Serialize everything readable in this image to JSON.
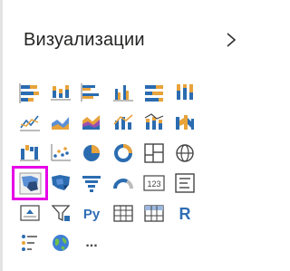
{
  "pane": {
    "title": "Визуализации",
    "collapse_icon": "chevron-right-icon",
    "selected_visual": "shape-map",
    "selection_color": "#e600e6",
    "accent_colors": [
      "#2b6cb0",
      "#e8a33a",
      "#5b8fd6",
      "#9b4fb0"
    ]
  },
  "visuals": [
    {
      "name": "stacked-bar-chart",
      "icon": "stacked-bar-icon"
    },
    {
      "name": "stacked-column-chart",
      "icon": "stacked-column-icon"
    },
    {
      "name": "clustered-bar-chart",
      "icon": "clustered-bar-icon"
    },
    {
      "name": "clustered-column-chart",
      "icon": "clustered-column-icon"
    },
    {
      "name": "100-stacked-bar-chart",
      "icon": "percent-bar-icon"
    },
    {
      "name": "100-stacked-column-chart",
      "icon": "percent-column-icon"
    },
    {
      "name": "line-chart",
      "icon": "line-chart-icon"
    },
    {
      "name": "area-chart",
      "icon": "area-chart-icon"
    },
    {
      "name": "stacked-area-chart",
      "icon": "stacked-area-icon"
    },
    {
      "name": "line-and-clustered-column-chart",
      "icon": "line-column-icon"
    },
    {
      "name": "line-and-stacked-column-chart",
      "icon": "line-stacked-column-icon"
    },
    {
      "name": "ribbon-chart",
      "icon": "ribbon-chart-icon"
    },
    {
      "name": "waterfall-chart",
      "icon": "waterfall-icon"
    },
    {
      "name": "scatter-chart",
      "icon": "scatter-icon"
    },
    {
      "name": "pie-chart",
      "icon": "pie-icon"
    },
    {
      "name": "donut-chart",
      "icon": "donut-icon"
    },
    {
      "name": "treemap",
      "icon": "treemap-icon"
    },
    {
      "name": "map",
      "icon": "globe-icon"
    },
    {
      "name": "shape-map",
      "icon": "shape-map-icon"
    },
    {
      "name": "filled-map",
      "icon": "filled-map-icon"
    },
    {
      "name": "funnel",
      "icon": "funnel-icon"
    },
    {
      "name": "gauge",
      "icon": "gauge-icon"
    },
    {
      "name": "card",
      "icon": "card-icon",
      "label": "123"
    },
    {
      "name": "multi-row-card",
      "icon": "multi-row-card-icon"
    },
    {
      "name": "kpi",
      "icon": "kpi-icon"
    },
    {
      "name": "slicer",
      "icon": "slicer-icon"
    },
    {
      "name": "python-visual",
      "icon": "python-icon",
      "label": "Py"
    },
    {
      "name": "table",
      "icon": "table-icon"
    },
    {
      "name": "matrix",
      "icon": "matrix-icon"
    },
    {
      "name": "r-script-visual",
      "icon": "r-icon",
      "label": "R"
    },
    {
      "name": "key-influencers",
      "icon": "key-influencers-icon"
    },
    {
      "name": "arcgis-map",
      "icon": "arcgis-globe-icon"
    },
    {
      "name": "more-visuals",
      "icon": "ellipsis-icon",
      "label": "..."
    }
  ]
}
